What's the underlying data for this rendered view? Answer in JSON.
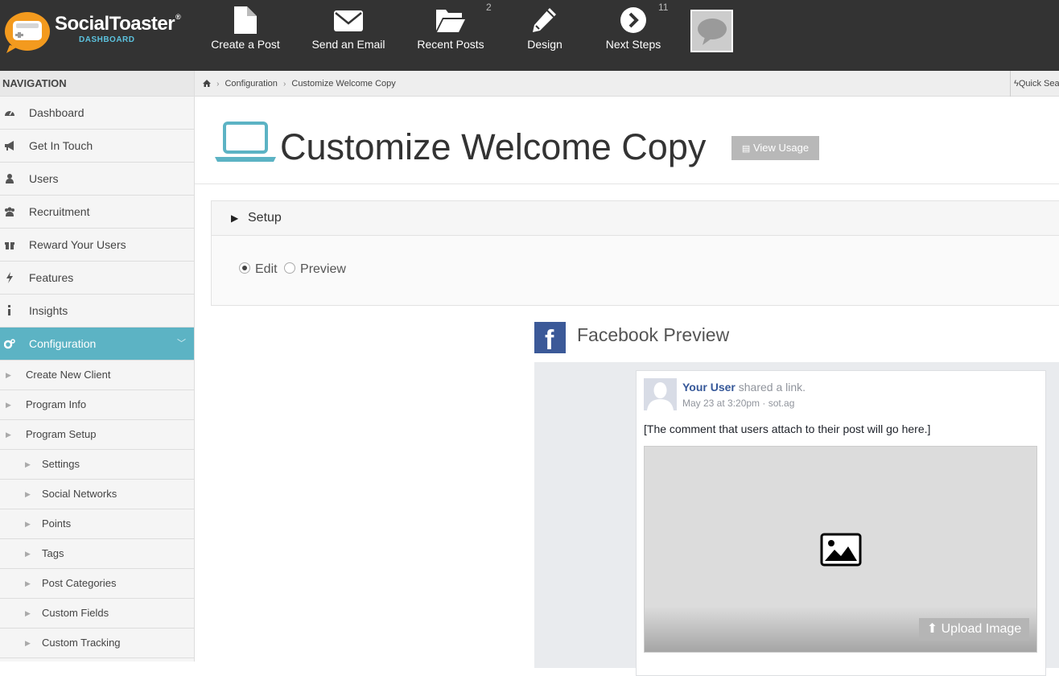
{
  "brand": {
    "name": "SocialToaster",
    "trademark": "®",
    "subtitle": "DASHBOARD"
  },
  "topnav": {
    "create_post": "Create a Post",
    "send_email": "Send an Email",
    "recent_posts": "Recent Posts",
    "recent_posts_badge": "2",
    "design": "Design",
    "next_steps": "Next Steps",
    "next_steps_badge": "11"
  },
  "sidebar": {
    "title": "NAVIGATION",
    "items": [
      {
        "label": "Dashboard",
        "icon": "dashboard-icon"
      },
      {
        "label": "Get In Touch",
        "icon": "bullhorn-icon"
      },
      {
        "label": "Users",
        "icon": "user-icon"
      },
      {
        "label": "Recruitment",
        "icon": "users-icon"
      },
      {
        "label": "Reward Your Users",
        "icon": "gift-icon"
      },
      {
        "label": "Features",
        "icon": "bolt-icon"
      },
      {
        "label": "Insights",
        "icon": "info-icon"
      },
      {
        "label": "Configuration",
        "icon": "cogs-icon",
        "active": true
      }
    ],
    "sub_items": [
      "Create New Client",
      "Program Info",
      "Program Setup"
    ],
    "sub_sub_items": [
      "Settings",
      "Social Networks",
      "Points",
      "Tags",
      "Post Categories",
      "Custom Fields",
      "Custom Tracking"
    ],
    "accent_color": "#5cb3c4"
  },
  "breadcrumb": {
    "items": [
      "Configuration",
      "Customize Welcome Copy"
    ],
    "quick_search": "Quick Sea"
  },
  "header": {
    "title": "Customize Welcome Copy",
    "view_usage": "View Usage"
  },
  "setup": {
    "title": "Setup",
    "mode_options": [
      "Edit",
      "Preview"
    ],
    "selected_mode": "Edit"
  },
  "facebook_preview": {
    "title": "Facebook Preview",
    "user_name": "Your User",
    "action": "shared a link.",
    "meta": "May 23 at 3:20pm · sot.ag",
    "comment": "[The comment that users attach to their post will go here.]",
    "upload_label": "Upload Image",
    "brand_color": "#3b5998"
  }
}
